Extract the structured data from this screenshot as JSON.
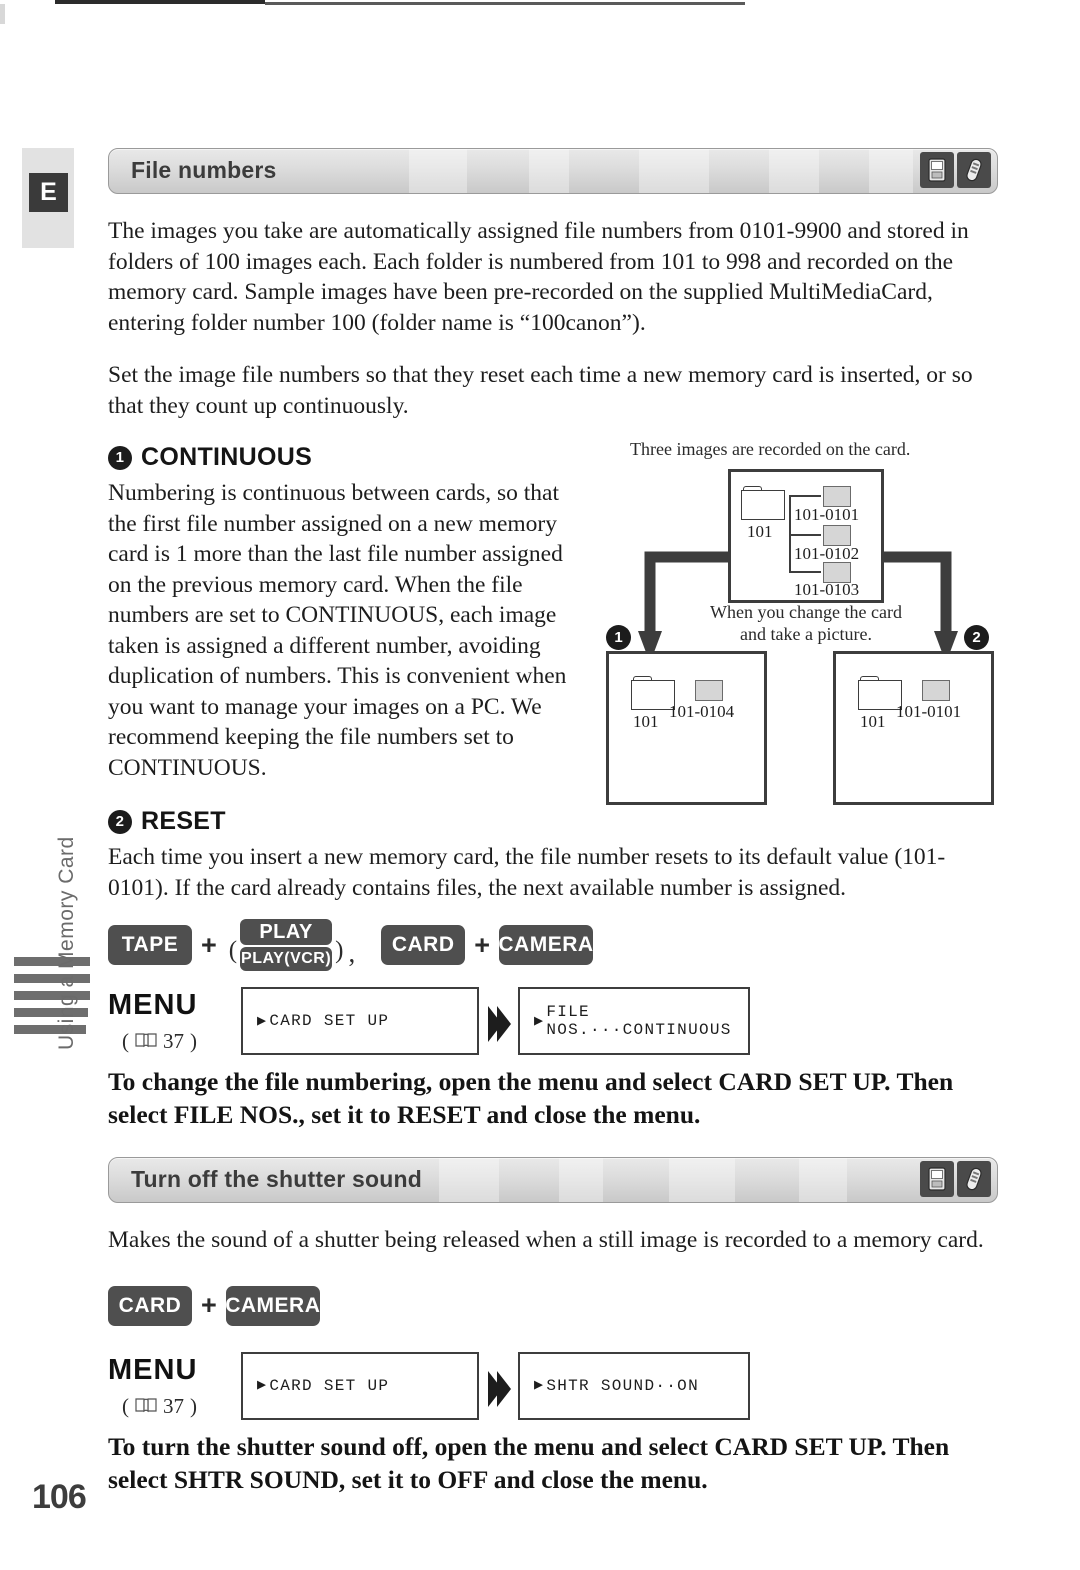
{
  "page": {
    "number": "106",
    "lang_badge": "E",
    "side_label": "Using a Memory Card"
  },
  "sections": [
    {
      "title": "File numbers",
      "icons": [
        "camcorder-icon",
        "remote-icon"
      ],
      "paragraphs": [
        "The images you take are automatically assigned file numbers from 0101-9900 and stored in folders of 100 images each. Each folder is numbered from 101 to 998 and recorded on the memory card. Sample images have been pre-recorded on the supplied MultiMediaCard, entering folder number 100 (folder name is “100canon”).",
        "Set the image file numbers so that they reset each time a new memory card is inserted, or so that they count up continuously."
      ],
      "steps": [
        {
          "num": "❶",
          "heading": "CONTINUOUS",
          "text": "Numbering is continuous between cards, so that the first file number assigned on a new memory card is 1 more than the last file number assigned on the previous memory card. When the file numbers are set to CONTINUOUS, each image taken is assigned a different number, avoiding duplication of numbers. This is convenient when you want to manage your images on a PC. We recommend keeping the file numbers set to CONTINUOUS."
        },
        {
          "num": "❷",
          "heading": "RESET",
          "text": "Each time you insert a new memory card, the file number resets to its default value (101-0101). If the card already contains files, the next available number is assigned."
        }
      ],
      "keys": {
        "tape": "TAPE",
        "plus1": "+",
        "paren_open": "(",
        "play": "PLAY",
        "play_vcr": "PLAY(VCR)",
        "paren_close": ")",
        "comma": ",",
        "card": "CARD",
        "plus2": "+",
        "camera": "CAMERA"
      },
      "menu": {
        "label": "MENU",
        "ref": "(  37)",
        "ref_page": "37",
        "box1": "CARD SET UP",
        "box2": "FILE NOS.···CONTINUOUS",
        "chevron": "double-chevron-right-icon"
      },
      "instruction": "To change the file numbering, open the menu and select CARD SET UP. Then select FILE NOS., set it to RESET and close the menu."
    },
    {
      "title": "Turn off the shutter sound",
      "icons": [
        "camcorder-icon",
        "remote-icon"
      ],
      "paragraphs": [
        "Makes the sound of a shutter being released when a still image is recorded to a memory card."
      ],
      "keys": {
        "card": "CARD",
        "plus": "+",
        "camera": "CAMERA"
      },
      "menu": {
        "label": "MENU",
        "ref": "(  37)",
        "ref_page": "37",
        "box1": "CARD SET UP",
        "box2": "SHTR SOUND··ON",
        "chevron": "double-chevron-right-icon"
      },
      "instruction": "To turn the shutter sound off, open the menu and select CARD SET UP. Then select SHTR SOUND, set it to OFF and close the menu."
    }
  ],
  "diagram": {
    "caption_top": "Three images are recorded on the card.",
    "caption_mid": "When you change the card and take a picture.",
    "main_box": {
      "folder_label": "101",
      "files": [
        "101-0101",
        "101-0102",
        "101-0103"
      ]
    },
    "left_box": {
      "marker": "❶",
      "folder_label": "101",
      "file": "101-0104"
    },
    "right_box": {
      "marker": "❷",
      "folder_label": "101",
      "file": "101-0101"
    }
  },
  "colors": {
    "bar_fill": "#dcdcdc",
    "bar_border": "#9a9a9a",
    "key_badge": "#4f4f4f",
    "sidebar_gray": "#6e6e6e",
    "ink": "#1d1d1d"
  }
}
